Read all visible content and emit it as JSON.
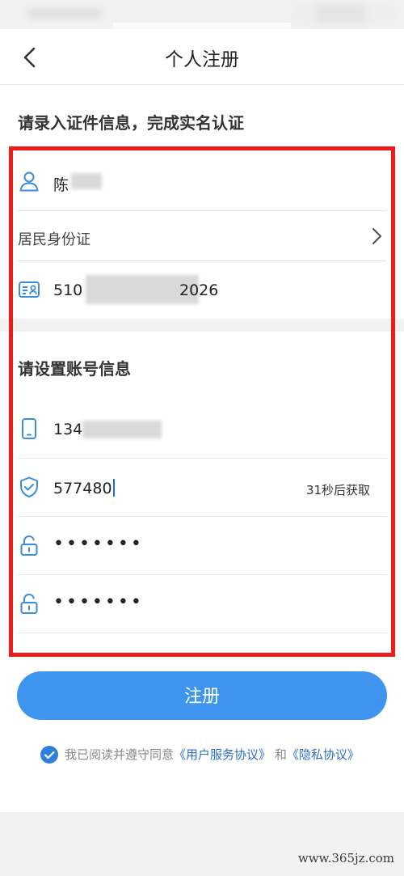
{
  "header": {
    "title": "个人注册"
  },
  "identity": {
    "heading": "请录入证件信息，完成实名认证",
    "name_value": "陈",
    "id_type": "居民身份证",
    "id_number_prefix": "510",
    "id_number_suffix": "2026"
  },
  "account": {
    "heading": "请设置账号信息",
    "phone_value": "134",
    "code_value": "577480",
    "countdown": "31秒后获取",
    "password_mask": "•••••••",
    "confirm_mask": "•••••••"
  },
  "submit": {
    "label": "注册"
  },
  "agreement": {
    "prefix": "我已阅读并遵守同意",
    "service_link": "《用户服务协议》",
    "and": "和",
    "privacy_link": "《隐私协议》",
    "checked": true
  },
  "watermark": "www.365jz.com",
  "colors": {
    "accent": "#3e94ee",
    "frame": "#ee1b1b",
    "link": "#2a6fc8",
    "icon": "#3b8de0"
  },
  "icons": [
    "back-chevron-icon",
    "user-icon",
    "chevron-right-icon",
    "id-card-icon",
    "phone-icon",
    "shield-check-icon",
    "lock-icon",
    "checkmark-icon"
  ]
}
